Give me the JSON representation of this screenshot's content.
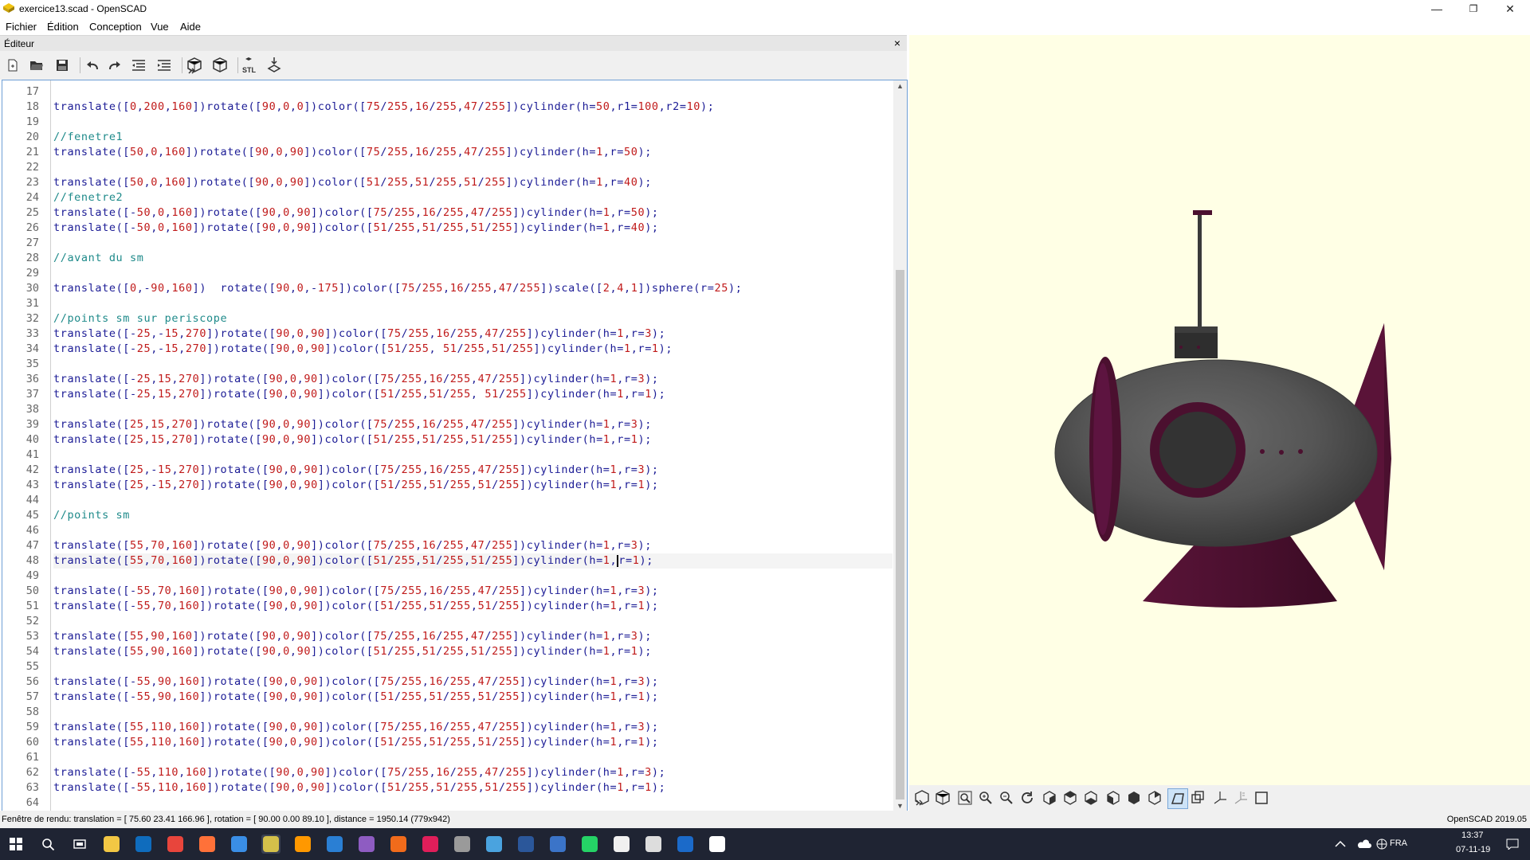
{
  "window": {
    "title": "exercice13.scad - OpenSCAD",
    "minimize_icon": "minimize-icon",
    "maximize_icon": "restore-icon",
    "close_icon": "close-icon"
  },
  "menu": {
    "items": [
      "Fichier",
      "Édition",
      "Conception",
      "Vue",
      "Aide"
    ]
  },
  "editor": {
    "title": "Éditeur",
    "close_glyph": "×",
    "toolbar_icons": [
      "new-file-icon",
      "open-file-icon",
      "save-icon",
      "undo-icon",
      "redo-icon",
      "unindent-icon",
      "indent-icon",
      "preview-icon",
      "render-icon",
      "export-stl-icon",
      "send-to-print-icon"
    ],
    "current_line": 48,
    "lines": [
      {
        "n": "17",
        "t": ""
      },
      {
        "n": "18",
        "t": "translate([0,200,160])rotate([90,0,0])color([75/255,16/255,47/255])cylinder(h=50,r1=100,r2=10);"
      },
      {
        "n": "19",
        "t": ""
      },
      {
        "n": "20",
        "t": "//fenetre1"
      },
      {
        "n": "21",
        "t": "translate([50,0,160])rotate([90,0,90])color([75/255,16/255,47/255])cylinder(h=1,r=50);"
      },
      {
        "n": "22",
        "t": ""
      },
      {
        "n": "23",
        "t": "translate([50,0,160])rotate([90,0,90])color([51/255,51/255,51/255])cylinder(h=1,r=40);"
      },
      {
        "n": "24",
        "t": "//fenetre2"
      },
      {
        "n": "25",
        "t": "translate([-50,0,160])rotate([90,0,90])color([75/255,16/255,47/255])cylinder(h=1,r=50);"
      },
      {
        "n": "26",
        "t": "translate([-50,0,160])rotate([90,0,90])color([51/255,51/255,51/255])cylinder(h=1,r=40);"
      },
      {
        "n": "27",
        "t": ""
      },
      {
        "n": "28",
        "t": "//avant du sm"
      },
      {
        "n": "29",
        "t": ""
      },
      {
        "n": "30",
        "t": "translate([0,-90,160])  rotate([90,0,-175])color([75/255,16/255,47/255])scale([2,4,1])sphere(r=25);"
      },
      {
        "n": "31",
        "t": ""
      },
      {
        "n": "32",
        "t": "//points sm sur periscope"
      },
      {
        "n": "33",
        "t": "translate([-25,-15,270])rotate([90,0,90])color([75/255,16/255,47/255])cylinder(h=1,r=3);"
      },
      {
        "n": "34",
        "t": "translate([-25,-15,270])rotate([90,0,90])color([51/255, 51/255,51/255])cylinder(h=1,r=1);"
      },
      {
        "n": "35",
        "t": ""
      },
      {
        "n": "36",
        "t": "translate([-25,15,270])rotate([90,0,90])color([75/255,16/255,47/255])cylinder(h=1,r=3);"
      },
      {
        "n": "37",
        "t": "translate([-25,15,270])rotate([90,0,90])color([51/255,51/255, 51/255])cylinder(h=1,r=1);"
      },
      {
        "n": "38",
        "t": ""
      },
      {
        "n": "39",
        "t": "translate([25,15,270])rotate([90,0,90])color([75/255,16/255,47/255])cylinder(h=1,r=3);"
      },
      {
        "n": "40",
        "t": "translate([25,15,270])rotate([90,0,90])color([51/255,51/255,51/255])cylinder(h=1,r=1);"
      },
      {
        "n": "41",
        "t": ""
      },
      {
        "n": "42",
        "t": "translate([25,-15,270])rotate([90,0,90])color([75/255,16/255,47/255])cylinder(h=1,r=3);"
      },
      {
        "n": "43",
        "t": "translate([25,-15,270])rotate([90,0,90])color([51/255,51/255,51/255])cylinder(h=1,r=1);"
      },
      {
        "n": "44",
        "t": ""
      },
      {
        "n": "45",
        "t": "//points sm"
      },
      {
        "n": "46",
        "t": ""
      },
      {
        "n": "47",
        "t": "translate([55,70,160])rotate([90,0,90])color([75/255,16/255,47/255])cylinder(h=1,r=3);"
      },
      {
        "n": "48",
        "t": "translate([55,70,160])rotate([90,0,90])color([51/255,51/255,51/255])cylinder(h=1,r=1);"
      },
      {
        "n": "49",
        "t": ""
      },
      {
        "n": "50",
        "t": "translate([-55,70,160])rotate([90,0,90])color([75/255,16/255,47/255])cylinder(h=1,r=3);"
      },
      {
        "n": "51",
        "t": "translate([-55,70,160])rotate([90,0,90])color([51/255,51/255,51/255])cylinder(h=1,r=1);"
      },
      {
        "n": "52",
        "t": ""
      },
      {
        "n": "53",
        "t": "translate([55,90,160])rotate([90,0,90])color([75/255,16/255,47/255])cylinder(h=1,r=3);"
      },
      {
        "n": "54",
        "t": "translate([55,90,160])rotate([90,0,90])color([51/255,51/255,51/255])cylinder(h=1,r=1);"
      },
      {
        "n": "55",
        "t": ""
      },
      {
        "n": "56",
        "t": "translate([-55,90,160])rotate([90,0,90])color([75/255,16/255,47/255])cylinder(h=1,r=3);"
      },
      {
        "n": "57",
        "t": "translate([-55,90,160])rotate([90,0,90])color([51/255,51/255,51/255])cylinder(h=1,r=1);"
      },
      {
        "n": "58",
        "t": ""
      },
      {
        "n": "59",
        "t": "translate([55,110,160])rotate([90,0,90])color([75/255,16/255,47/255])cylinder(h=1,r=3);"
      },
      {
        "n": "60",
        "t": "translate([55,110,160])rotate([90,0,90])color([51/255,51/255,51/255])cylinder(h=1,r=1);"
      },
      {
        "n": "61",
        "t": ""
      },
      {
        "n": "62",
        "t": "translate([-55,110,160])rotate([90,0,90])color([75/255,16/255,47/255])cylinder(h=1,r=3);"
      },
      {
        "n": "63",
        "t": "translate([-55,110,160])rotate([90,0,90])color([51/255,51/255,51/255])cylinder(h=1,r=1);"
      },
      {
        "n": "64",
        "t": ""
      }
    ]
  },
  "viewer": {
    "background": "#ffffe5",
    "model_colors": {
      "hull": "#585858",
      "accent": "#4b102f",
      "window": "#333333"
    },
    "toolbar_icons": [
      "preview-icon",
      "render-icon",
      "view-all-icon",
      "zoom-in-icon",
      "zoom-out-icon",
      "reset-view-icon",
      "view-right-icon",
      "view-top-icon",
      "view-bottom-icon",
      "view-left-icon",
      "view-front-icon",
      "view-back-icon",
      "perspective-icon",
      "orthogonal-icon",
      "show-axes-icon",
      "show-scale-icon",
      "show-edges-icon"
    ]
  },
  "status": {
    "left": "Fenêtre de rendu: translation = [ 75.60 23.41 166.96 ], rotation = [ 90.00 0.00 89.10 ], distance = 1950.14 (779x942)",
    "right": "OpenSCAD 2019.05"
  },
  "taskbar": {
    "apps": [
      "windows-start-icon",
      "search-icon",
      "task-view-icon",
      "file-explorer-icon",
      "outlook-icon",
      "chrome-icon",
      "firefox-icon",
      "browser-icon",
      "openscad-icon",
      "sublime-icon",
      "vscode-icon",
      "visual-studio-icon",
      "app-orange-icon",
      "slack-icon",
      "app-icon",
      "app-cloud-icon",
      "word-icon",
      "cube-app-icon",
      "whatsapp-icon",
      "smiley-app-icon",
      "mail-icon",
      "app-window-icon",
      "settings-icon"
    ],
    "language": "FRA",
    "time": "13:37",
    "date": "07-11-19"
  }
}
